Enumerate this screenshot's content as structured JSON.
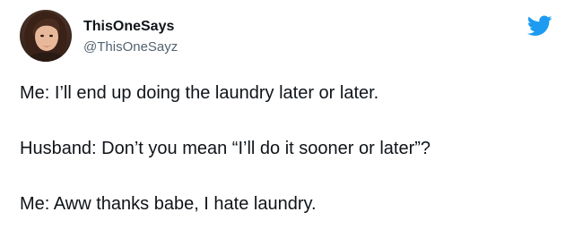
{
  "author": {
    "display_name": "ThisOneSays",
    "handle": "@ThisOneSayz",
    "avatar_icon": "profile-photo"
  },
  "brand": {
    "logo_icon": "twitter-bird-icon",
    "color": "#1d9bf0"
  },
  "tweet": {
    "lines": [
      "Me: I’ll end up doing the laundry later or later.",
      "Husband: Don’t you mean “I’ll do it sooner or later”?",
      "Me: Aww thanks babe, I hate laundry."
    ]
  },
  "colors": {
    "text": "#0f1419",
    "secondary_text": "#536471",
    "background": "#ffffff"
  }
}
